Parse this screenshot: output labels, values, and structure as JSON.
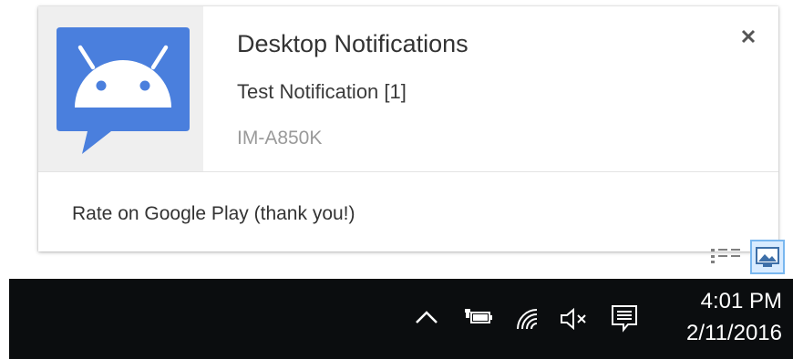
{
  "notification": {
    "title": "Desktop Notifications",
    "message": "Test Notification [1]",
    "context": "IM-A850K",
    "close_icon": "close-icon",
    "app_icon": "android-chat-icon",
    "action_label": "Rate on Google Play (thank you!)",
    "accent_color": "#4a7fdd"
  },
  "taskbar": {
    "tray": {
      "chevron_icon": "chevron-up-icon",
      "battery_icon": "battery-power-icon",
      "wifi_icon": "wifi-icon",
      "volume_icon": "volume-muted-icon",
      "action_center_icon": "action-center-icon",
      "show_desktop_icon": "show-desktop-icon"
    },
    "clock": {
      "time": "4:01 PM",
      "date": "2/11/2016"
    },
    "background_color": "#0b0d0f"
  }
}
